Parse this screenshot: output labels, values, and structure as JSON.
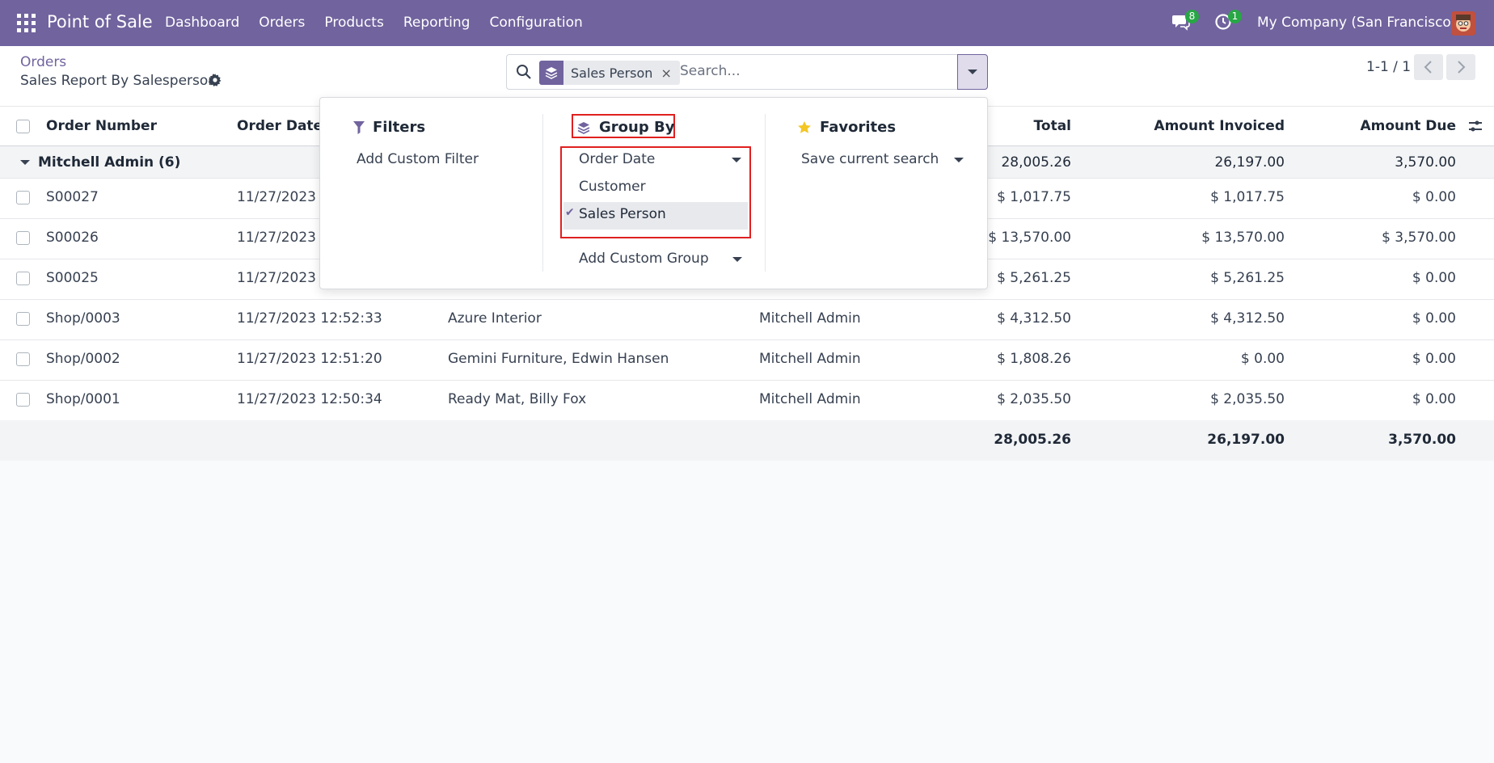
{
  "navbar": {
    "app_name": "Point of Sale",
    "menu": [
      "Dashboard",
      "Orders",
      "Products",
      "Reporting",
      "Configuration"
    ],
    "messages_count": "8",
    "activities_count": "1",
    "company": "My Company (San Francisco)",
    "brand_color": "#71639e"
  },
  "control": {
    "breadcrumb": "Orders",
    "title": "Sales Report By Salesperson",
    "search": {
      "facet_label": "Sales Person",
      "facet_close": "×",
      "placeholder": "Search..."
    },
    "pager": "1-1 / 1"
  },
  "dropdown": {
    "filters": {
      "heading": "Filters",
      "add_custom": "Add Custom Filter"
    },
    "group_by": {
      "heading": "Group By",
      "options": [
        "Order Date",
        "Customer",
        "Sales Person"
      ],
      "selected": "Sales Person",
      "add_custom": "Add Custom Group"
    },
    "favorites": {
      "heading": "Favorites",
      "save_search": "Save current search"
    }
  },
  "table": {
    "headers": [
      "Order Number",
      "Order Date",
      "Total",
      "Amount Invoiced",
      "Amount Due"
    ],
    "group": {
      "label": "Mitchell Admin (6)",
      "total": "28,005.26",
      "invoiced": "26,197.00",
      "due": "3,570.00"
    },
    "rows": [
      {
        "order": "S00027",
        "date": "11/27/2023 1",
        "customer": "",
        "salesperson": "",
        "total": "$ 1,017.75",
        "invoiced": "$ 1,017.75",
        "due": "$ 0.00"
      },
      {
        "order": "S00026",
        "date": "11/27/2023 1",
        "customer": "",
        "salesperson": "",
        "total": "$ 13,570.00",
        "invoiced": "$ 13,570.00",
        "due": "$ 3,570.00"
      },
      {
        "order": "S00025",
        "date": "11/27/2023 1",
        "customer": "",
        "salesperson": "",
        "total": "$ 5,261.25",
        "invoiced": "$ 5,261.25",
        "due": "$ 0.00"
      },
      {
        "order": "Shop/0003",
        "date": "11/27/2023 12:52:33",
        "customer": "Azure Interior",
        "salesperson": "Mitchell Admin",
        "total": "$ 4,312.50",
        "invoiced": "$ 4,312.50",
        "due": "$ 0.00"
      },
      {
        "order": "Shop/0002",
        "date": "11/27/2023 12:51:20",
        "customer": "Gemini Furniture, Edwin Hansen",
        "salesperson": "Mitchell Admin",
        "total": "$ 1,808.26",
        "invoiced": "$ 0.00",
        "due": "$ 0.00"
      },
      {
        "order": "Shop/0001",
        "date": "11/27/2023 12:50:34",
        "customer": "Ready Mat, Billy Fox",
        "salesperson": "Mitchell Admin",
        "total": "$ 2,035.50",
        "invoiced": "$ 2,035.50",
        "due": "$ 0.00"
      }
    ],
    "footer": {
      "total": "28,005.26",
      "invoiced": "26,197.00",
      "due": "3,570.00"
    }
  }
}
